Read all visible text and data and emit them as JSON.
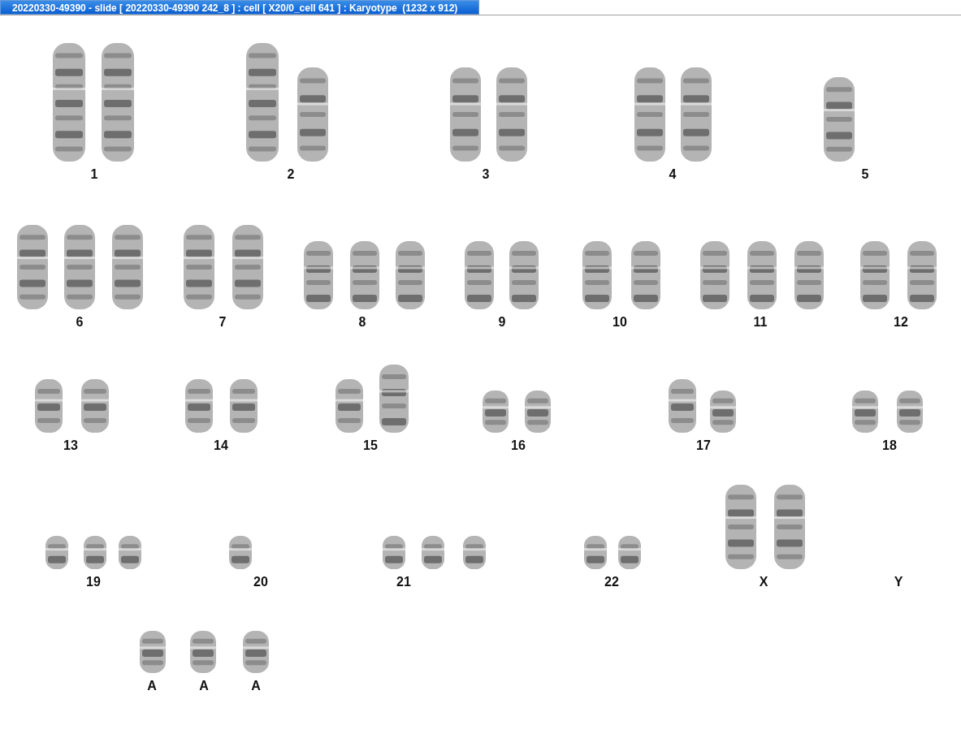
{
  "window": {
    "title": "20220330-49390 - slide [ 20220330-49390 242_8 ] : cell [ X20/0_cell 641 ] : Karyotype  (1232 x 912)"
  },
  "karyotype": {
    "groups": [
      {
        "label": "1",
        "chromosomes": [
          {
            "kind": "xl"
          },
          {
            "kind": "xl"
          }
        ]
      },
      {
        "label": "2",
        "chromosomes": [
          {
            "kind": "xl"
          },
          {
            "kind": "l"
          }
        ]
      },
      {
        "label": "3",
        "chromosomes": [
          {
            "kind": "l"
          },
          {
            "kind": "l"
          }
        ]
      },
      {
        "label": "4",
        "chromosomes": [
          {
            "kind": "l"
          },
          {
            "kind": "l"
          }
        ]
      },
      {
        "label": "5",
        "chromosomes": [
          {
            "kind": "m"
          }
        ]
      },
      {
        "label": "6",
        "chromosomes": [
          {
            "kind": "m"
          },
          {
            "kind": "m"
          },
          {
            "kind": "m"
          }
        ]
      },
      {
        "label": "7",
        "chromosomes": [
          {
            "kind": "m"
          },
          {
            "kind": "m"
          }
        ]
      },
      {
        "label": "8",
        "chromosomes": [
          {
            "kind": "s"
          },
          {
            "kind": "s"
          },
          {
            "kind": "s"
          }
        ]
      },
      {
        "label": "9",
        "chromosomes": [
          {
            "kind": "s"
          },
          {
            "kind": "s"
          }
        ]
      },
      {
        "label": "10",
        "chromosomes": [
          {
            "kind": "s"
          },
          {
            "kind": "s"
          }
        ]
      },
      {
        "label": "11",
        "chromosomes": [
          {
            "kind": "s"
          },
          {
            "kind": "s"
          },
          {
            "kind": "s"
          }
        ]
      },
      {
        "label": "12",
        "chromosomes": [
          {
            "kind": "s"
          },
          {
            "kind": "s"
          }
        ]
      },
      {
        "label": "13",
        "chromosomes": [
          {
            "kind": "xs"
          },
          {
            "kind": "xs"
          }
        ]
      },
      {
        "label": "14",
        "chromosomes": [
          {
            "kind": "xs"
          },
          {
            "kind": "xs"
          }
        ]
      },
      {
        "label": "15",
        "chromosomes": [
          {
            "kind": "xs"
          },
          {
            "kind": "s"
          }
        ]
      },
      {
        "label": "16",
        "chromosomes": [
          {
            "kind": "xxs"
          },
          {
            "kind": "xxs"
          }
        ]
      },
      {
        "label": "17",
        "chromosomes": [
          {
            "kind": "xs"
          },
          {
            "kind": "xxs"
          }
        ]
      },
      {
        "label": "18",
        "chromosomes": [
          {
            "kind": "xxs"
          },
          {
            "kind": "xxs"
          }
        ]
      },
      {
        "label": "19",
        "chromosomes": [
          {
            "kind": "tiny"
          },
          {
            "kind": "tiny"
          },
          {
            "kind": "tiny"
          }
        ]
      },
      {
        "label": "20",
        "chromosomes": [
          {
            "kind": "tiny"
          }
        ]
      },
      {
        "label": "21",
        "chromosomes": [
          {
            "kind": "tiny"
          },
          {
            "kind": "tiny"
          },
          {
            "kind": "tiny"
          }
        ]
      },
      {
        "label": "22",
        "chromosomes": [
          {
            "kind": "tiny"
          },
          {
            "kind": "tiny"
          }
        ]
      },
      {
        "label": "X",
        "chromosomes": [
          {
            "kind": "m"
          },
          {
            "kind": "m"
          }
        ]
      },
      {
        "label": "Y"
      },
      {
        "label": "A",
        "chromosomes": [
          {
            "kind": "xxs"
          }
        ]
      },
      {
        "label": "A",
        "chromosomes": [
          {
            "kind": "xxs"
          }
        ]
      },
      {
        "label": "A",
        "chromosomes": [
          {
            "kind": "xxs"
          }
        ]
      }
    ]
  }
}
